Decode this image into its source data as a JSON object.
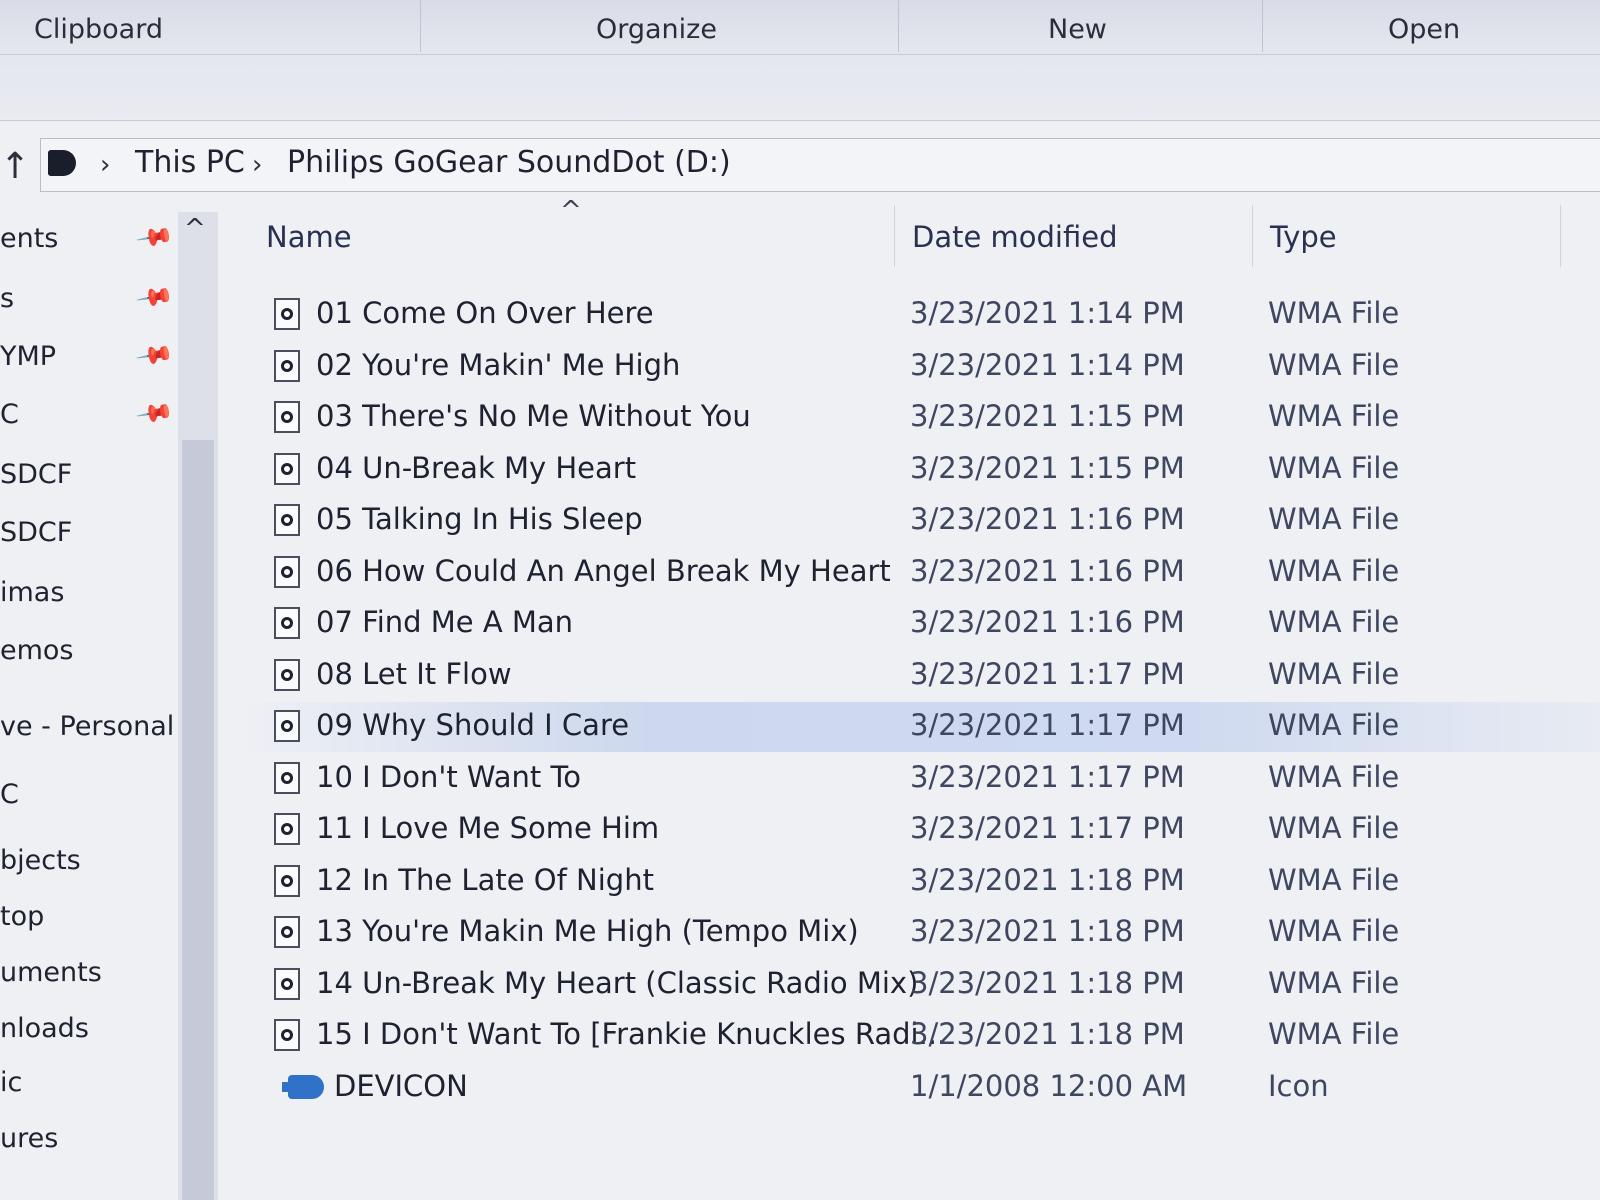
{
  "ribbon": {
    "groups": [
      "Clipboard",
      "Organize",
      "New",
      "Open"
    ]
  },
  "address": {
    "crumbs": [
      "This PC",
      "Philips GoGear SoundDot (D:)"
    ]
  },
  "nav": {
    "items": [
      "ents",
      "s",
      "YMP",
      "C",
      "SDCF",
      "SDCF",
      "imas",
      "emos",
      "ve - Personal",
      "C",
      "bjects",
      "top",
      "uments",
      "nloads",
      "ic",
      "ures"
    ]
  },
  "columns": {
    "name": "Name",
    "date": "Date modified",
    "type": "Type"
  },
  "files": [
    {
      "name": "01 Come On Over Here",
      "date": "3/23/2021 1:14 PM",
      "type": "WMA File",
      "icon": "audio-file-icon"
    },
    {
      "name": "02 You're Makin' Me High",
      "date": "3/23/2021 1:14 PM",
      "type": "WMA File",
      "icon": "audio-file-icon"
    },
    {
      "name": "03 There's No Me Without You",
      "date": "3/23/2021 1:15 PM",
      "type": "WMA File",
      "icon": "audio-file-icon"
    },
    {
      "name": "04 Un-Break My Heart",
      "date": "3/23/2021 1:15 PM",
      "type": "WMA File",
      "icon": "audio-file-icon"
    },
    {
      "name": "05 Talking In His Sleep",
      "date": "3/23/2021 1:16 PM",
      "type": "WMA File",
      "icon": "audio-file-icon"
    },
    {
      "name": "06 How Could An Angel Break My Heart",
      "date": "3/23/2021 1:16 PM",
      "type": "WMA File",
      "icon": "audio-file-icon"
    },
    {
      "name": "07 Find Me A Man",
      "date": "3/23/2021 1:16 PM",
      "type": "WMA File",
      "icon": "audio-file-icon"
    },
    {
      "name": "08 Let It Flow",
      "date": "3/23/2021 1:17 PM",
      "type": "WMA File",
      "icon": "audio-file-icon"
    },
    {
      "name": "09 Why Should I Care",
      "date": "3/23/2021 1:17 PM",
      "type": "WMA File",
      "icon": "audio-file-icon",
      "selected": true
    },
    {
      "name": "10 I Don't Want To",
      "date": "3/23/2021 1:17 PM",
      "type": "WMA File",
      "icon": "audio-file-icon"
    },
    {
      "name": "11 I Love Me Some Him",
      "date": "3/23/2021 1:17 PM",
      "type": "WMA File",
      "icon": "audio-file-icon"
    },
    {
      "name": "12 In The Late Of Night",
      "date": "3/23/2021 1:18 PM",
      "type": "WMA File",
      "icon": "audio-file-icon"
    },
    {
      "name": "13 You're Makin Me High (Tempo Mix)",
      "date": "3/23/2021 1:18 PM",
      "type": "WMA File",
      "icon": "audio-file-icon"
    },
    {
      "name": "14 Un-Break My Heart (Classic Radio Mix)",
      "date": "3/23/2021 1:18 PM",
      "type": "WMA File",
      "icon": "audio-file-icon"
    },
    {
      "name": "15 I Don't Want To [Frankie Knuckles Radi...",
      "date": "3/23/2021 1:18 PM",
      "type": "WMA File",
      "icon": "audio-file-icon"
    },
    {
      "name": "DEVICON",
      "date": "1/1/2008 12:00 AM",
      "type": "Icon",
      "icon": "device-icon"
    }
  ]
}
